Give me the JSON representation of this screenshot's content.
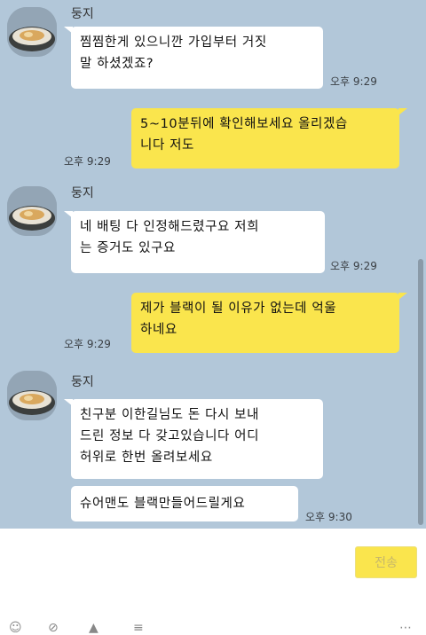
{
  "chat": {
    "contact_name": "둥지",
    "messages": [
      {
        "from": "them",
        "lines": [
          "찜찜한게 있으니깐 가입부터 거짓",
          "말 하셨겠죠?"
        ],
        "time": "오후 9:29"
      },
      {
        "from": "me",
        "lines": [
          "5~10분뒤에 확인해보세요 올리겠습",
          "니다 저도"
        ],
        "time": "오후 9:29"
      },
      {
        "from": "them",
        "lines": [
          "네 배팅 다 인정해드렸구요 저희",
          "는 증거도 있구요"
        ],
        "time": "오후 9:29"
      },
      {
        "from": "me",
        "lines": [
          "제가 블랙이 될 이유가 없는데 억울",
          "하네요"
        ],
        "time": "오후 9:29"
      },
      {
        "from": "them",
        "lines": [
          "친구분 이한길님도 돈 다시 보내",
          "드린 정보 다 갖고있습니다 어디",
          "허위로 한번 올려보세요"
        ],
        "time": ""
      },
      {
        "from": "them",
        "lines": [
          "슈어맨도 블랙만들어드릴게요"
        ],
        "time": "오후 9:30"
      }
    ]
  },
  "composer": {
    "send_label": "전송"
  },
  "colors": {
    "chat_bg": "#b2c7d9",
    "my_bubble": "#fae54d",
    "their_bubble": "#ffffff"
  }
}
